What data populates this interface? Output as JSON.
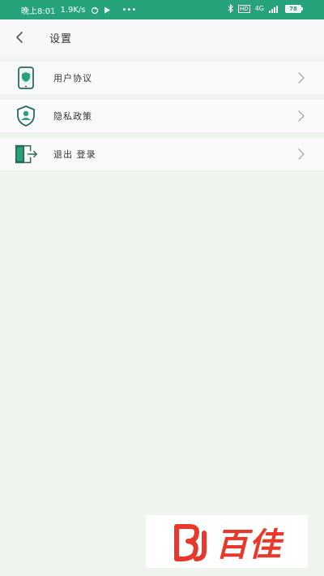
{
  "status_bar": {
    "time": "晚上8:01",
    "speed": "1.9K/s",
    "battery": "78",
    "dots": "•••",
    "hd_badge": "HD",
    "network": "4G"
  },
  "header": {
    "title": "设置"
  },
  "menu": {
    "items": [
      {
        "label": "用户协议",
        "icon": "phone-shield-icon"
      },
      {
        "label": "隐私政策",
        "icon": "privacy-shield-icon"
      },
      {
        "label": "退出 登录",
        "icon": "logout-door-icon"
      }
    ]
  },
  "watermark": {
    "text": "百佳",
    "color": "#e8382b"
  },
  "colors": {
    "status_bar": "#27a37b",
    "accent": "#27a37b",
    "background": "#eff5ee",
    "icon_dark": "#2a6a5a"
  }
}
